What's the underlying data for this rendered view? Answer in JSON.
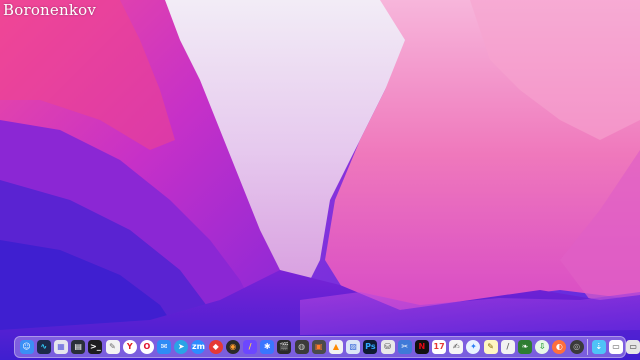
{
  "watermark": {
    "text": "Boronenkov"
  },
  "desktop": {
    "wallpaper": "macOS Monterey magenta-purple abstract"
  },
  "dock": {
    "apps": [
      {
        "id": "finder",
        "icon": "finder-icon",
        "glyph": "☺",
        "bg": "#3b8ff5",
        "fg": "#ffffff",
        "round": false
      },
      {
        "id": "activity-monitor",
        "icon": "activity-monitor-icon",
        "glyph": "∿",
        "bg": "#1c2a4a",
        "fg": "#34d2ff",
        "round": false
      },
      {
        "id": "launchpad",
        "icon": "launchpad-icon",
        "glyph": "▦",
        "bg": "#e6e6ee",
        "fg": "#5a5adc",
        "round": false
      },
      {
        "id": "mission-control",
        "icon": "mission-control-icon",
        "glyph": "▤",
        "bg": "#2a2f3a",
        "fg": "#ffffff",
        "round": false
      },
      {
        "id": "terminal",
        "icon": "terminal-icon",
        "glyph": ">_",
        "bg": "#1d1d1f",
        "fg": "#ffffff",
        "round": false
      },
      {
        "id": "script-editor",
        "icon": "script-editor-icon",
        "glyph": "✎",
        "bg": "#f3f3f3",
        "fg": "#6a6a6a",
        "round": false
      },
      {
        "id": "yandex-browser",
        "icon": "yandex-browser-icon",
        "glyph": "Y",
        "bg": "#ffffff",
        "fg": "#e01f1f",
        "round": true
      },
      {
        "id": "opera",
        "icon": "opera-icon",
        "glyph": "O",
        "bg": "#ffffff",
        "fg": "#e01330",
        "round": true
      },
      {
        "id": "mail",
        "icon": "mail-icon",
        "glyph": "✉",
        "bg": "#2f8bf5",
        "fg": "#ffffff",
        "round": false
      },
      {
        "id": "telegram",
        "icon": "telegram-icon",
        "glyph": "➤",
        "bg": "#2aa3e6",
        "fg": "#ffffff",
        "round": true
      },
      {
        "id": "zoom",
        "icon": "zoom-icon",
        "glyph": "zm",
        "bg": "#2d8cff",
        "fg": "#ffffff",
        "round": true
      },
      {
        "id": "anydesk",
        "icon": "anydesk-icon",
        "glyph": "◆",
        "bg": "#e53935",
        "fg": "#ffffff",
        "round": true
      },
      {
        "id": "davinci-resolve",
        "icon": "davinci-resolve-icon",
        "glyph": "◉",
        "bg": "#2a2a2a",
        "fg": "#ff9b2e",
        "round": true
      },
      {
        "id": "pencil",
        "icon": "pencil-icon",
        "glyph": "/",
        "bg": "#6c47ff",
        "fg": "#ffd24a",
        "round": false
      },
      {
        "id": "capture-one",
        "icon": "capture-one-icon",
        "glyph": "✱",
        "bg": "#3a76ff",
        "fg": "#ffffff",
        "round": false
      },
      {
        "id": "final-cut-pro",
        "icon": "final-cut-pro-icon",
        "glyph": "🎬",
        "bg": "#2a2a2a",
        "fg": "#ffffff",
        "round": false
      },
      {
        "id": "motion",
        "icon": "motion-icon",
        "glyph": "◍",
        "bg": "#3b3b3b",
        "fg": "#c7c7c7",
        "round": false
      },
      {
        "id": "compressor",
        "icon": "compressor-icon",
        "glyph": "▣",
        "bg": "#4b4b4b",
        "fg": "#ff7c2a",
        "round": false
      },
      {
        "id": "vlc",
        "icon": "vlc-icon",
        "glyph": "▲",
        "bg": "#f2f2f2",
        "fg": "#ff8a00",
        "round": false
      },
      {
        "id": "preview",
        "icon": "preview-icon",
        "glyph": "▨",
        "bg": "#dbe6f7",
        "fg": "#3a6ad8",
        "round": false
      },
      {
        "id": "photoshop",
        "icon": "photoshop-icon",
        "glyph": "Ps",
        "bg": "#0f1b33",
        "fg": "#31a8ff",
        "round": false
      },
      {
        "id": "disk-utility",
        "icon": "disk-utility-icon",
        "glyph": "⛁",
        "bg": "#e9e9e9",
        "fg": "#4a4a4a",
        "round": false
      },
      {
        "id": "system-tools",
        "icon": "system-tools-icon",
        "glyph": "✂",
        "bg": "#3f7ad8",
        "fg": "#ffffff",
        "round": false
      },
      {
        "id": "netflix",
        "icon": "netflix-icon",
        "glyph": "N",
        "bg": "#111111",
        "fg": "#e50914",
        "round": false
      },
      {
        "id": "calendar",
        "icon": "calendar-icon",
        "glyph": "17",
        "bg": "#ffffff",
        "fg": "#e53935",
        "round": false
      },
      {
        "id": "textedit",
        "icon": "textedit-icon",
        "glyph": "✍",
        "bg": "#f5f5f5",
        "fg": "#555555",
        "round": false
      },
      {
        "id": "safari",
        "icon": "safari-icon",
        "glyph": "✦",
        "bg": "#e9f3ff",
        "fg": "#2a7df5",
        "round": true
      },
      {
        "id": "notes",
        "icon": "notes-icon",
        "glyph": "✎",
        "bg": "#fff6c2",
        "fg": "#8a6a00",
        "round": false
      },
      {
        "id": "scripts",
        "icon": "scripts-icon",
        "glyph": "/",
        "bg": "#f2f2f2",
        "fg": "#6a6a6a",
        "round": false
      },
      {
        "id": "leaf",
        "icon": "leaf-icon",
        "glyph": "❧",
        "bg": "#2e7d32",
        "fg": "#ffffff",
        "round": false
      },
      {
        "id": "cloud-download",
        "icon": "cloud-download-icon",
        "glyph": "⇩",
        "bg": "#e8f7e8",
        "fg": "#2e9e3c",
        "round": true
      },
      {
        "id": "transmit",
        "icon": "transmit-icon",
        "glyph": "◐",
        "bg": "#ff6f3c",
        "fg": "#ffffff",
        "round": true
      },
      {
        "id": "disk-drill",
        "icon": "disk-drill-icon",
        "glyph": "◎",
        "bg": "#3a3a3a",
        "fg": "#bbbbbb",
        "round": true
      }
    ],
    "trailing": [
      {
        "id": "downloads-folder",
        "icon": "downloads-folder-icon",
        "glyph": "⇣",
        "bg": "#4fc3f7",
        "fg": "#ffffff",
        "round": false
      },
      {
        "id": "documents-stack",
        "icon": "documents-stack-icon",
        "glyph": "▭",
        "bg": "#ffffff",
        "fg": "#555555",
        "round": false
      },
      {
        "id": "screen-sharing",
        "icon": "screen-sharing-icon",
        "glyph": "▭",
        "bg": "#e6e6e6",
        "fg": "#333333",
        "round": false
      },
      {
        "id": "trash",
        "icon": "trash-icon",
        "glyph": "⌧",
        "bg": "#d9d9e6",
        "fg": "#7a7a8a",
        "round": false
      }
    ]
  }
}
